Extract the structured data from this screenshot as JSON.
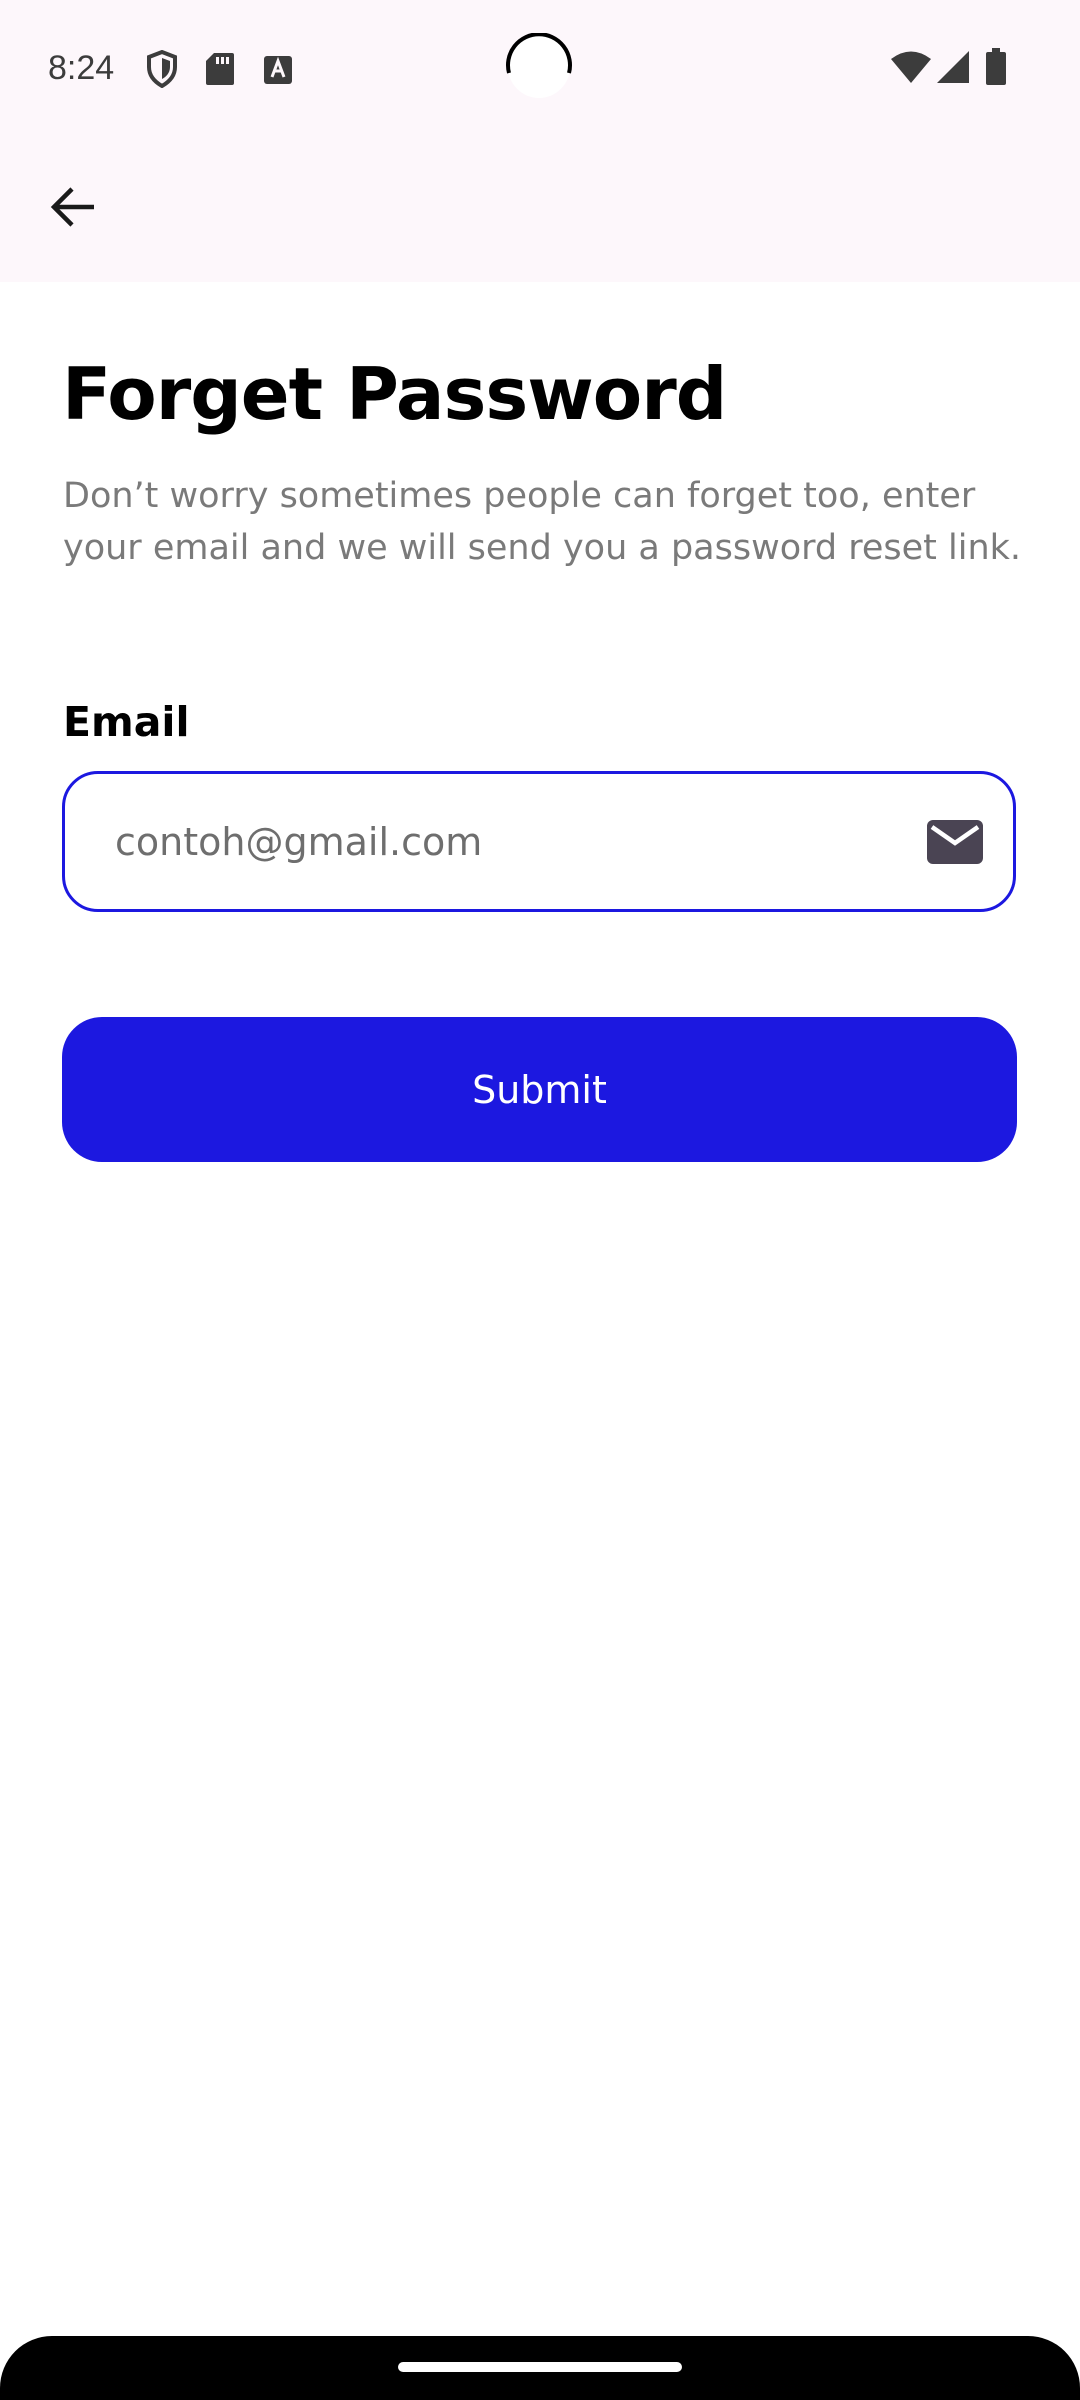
{
  "status_bar": {
    "time": "8:24",
    "left_icons": [
      "shield-icon",
      "sd-card-icon",
      "keyboard-a-icon"
    ],
    "right_icons": [
      "wifi-icon",
      "signal-icon",
      "battery-icon"
    ]
  },
  "header": {
    "back_icon": "arrow-left-icon"
  },
  "main": {
    "title": "Forget Password",
    "description": "Don’t worry sometimes people can forget too, enter your email and we will send you a password reset link.",
    "email_label": "Email",
    "email_placeholder": "contoh@gmail.com",
    "email_value": "",
    "email_icon": "mail-icon",
    "submit_label": "Submit"
  },
  "colors": {
    "accent": "#1c18e0",
    "header_background": "#fdf7fb",
    "description_text": "#7a7a7a"
  }
}
